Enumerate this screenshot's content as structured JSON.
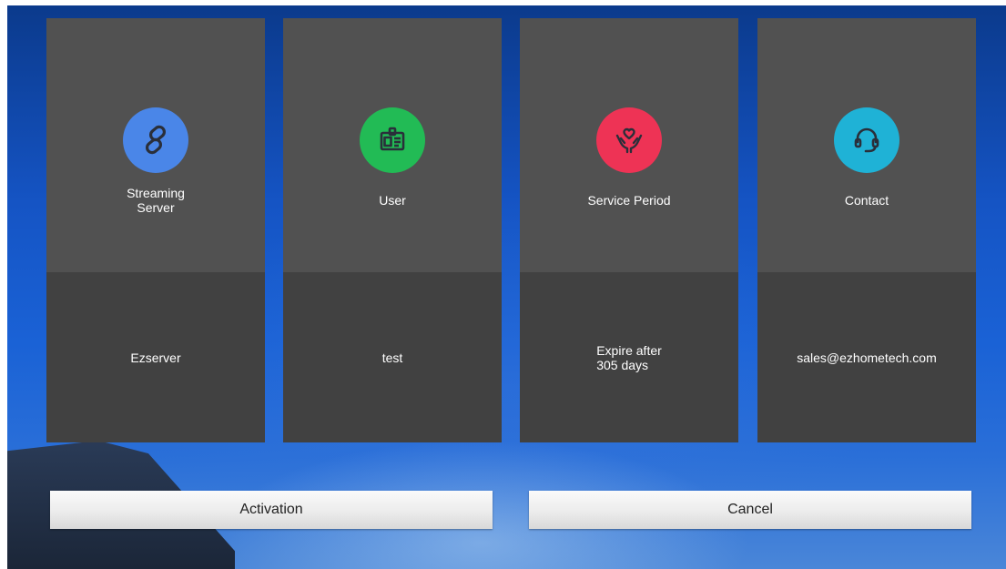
{
  "colors": {
    "server_icon_bg": "#4a86e8",
    "user_icon_bg": "#22bb55",
    "service_icon_bg": "#ee3355",
    "contact_icon_bg": "#1fb2d6"
  },
  "cards": [
    {
      "icon": "link-icon",
      "label": "Streaming\nServer",
      "value": "Ezserver"
    },
    {
      "icon": "id-card-icon",
      "label": "User",
      "value": "test"
    },
    {
      "icon": "heart-hands-icon",
      "label": "Service Period",
      "value": "Expire after\n305 days"
    },
    {
      "icon": "headset-icon",
      "label": "Contact",
      "value": "sales@ezhometech.com"
    }
  ],
  "buttons": {
    "activation_label": "Activation",
    "cancel_label": "Cancel"
  }
}
